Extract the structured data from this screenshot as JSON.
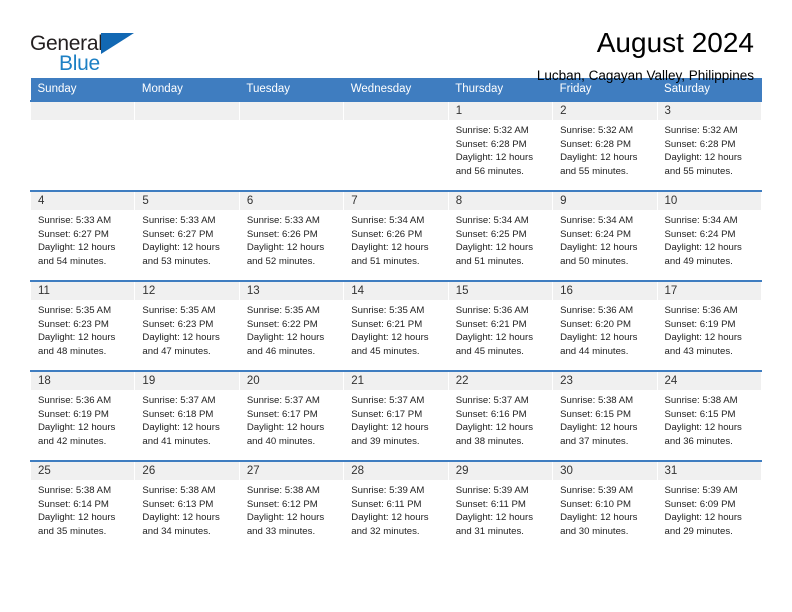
{
  "brand": {
    "name_part1": "General",
    "name_part2": "Blue",
    "logo_icon": "triangle-logo-icon"
  },
  "header": {
    "title": "August 2024",
    "subtitle": "Lucban, Cagayan Valley, Philippines"
  },
  "colors": {
    "header_blue": "#3f7dc0",
    "brand_blue": "#1d80c4",
    "logo_blue": "#1268b3",
    "daynum_bg": "#f0f0f0"
  },
  "calendar": {
    "weekday_headers": [
      "Sunday",
      "Monday",
      "Tuesday",
      "Wednesday",
      "Thursday",
      "Friday",
      "Saturday"
    ],
    "labels": {
      "sunrise": "Sunrise:",
      "sunset": "Sunset:",
      "daylight": "Daylight:"
    },
    "weeks": [
      [
        {
          "day": "",
          "empty": true
        },
        {
          "day": "",
          "empty": true
        },
        {
          "day": "",
          "empty": true
        },
        {
          "day": "",
          "empty": true
        },
        {
          "day": "1",
          "sunrise": "Sunrise: 5:32 AM",
          "sunset": "Sunset: 6:28 PM",
          "daylight_line1": "Daylight: 12 hours",
          "daylight_line2": "and 56 minutes."
        },
        {
          "day": "2",
          "sunrise": "Sunrise: 5:32 AM",
          "sunset": "Sunset: 6:28 PM",
          "daylight_line1": "Daylight: 12 hours",
          "daylight_line2": "and 55 minutes."
        },
        {
          "day": "3",
          "sunrise": "Sunrise: 5:32 AM",
          "sunset": "Sunset: 6:28 PM",
          "daylight_line1": "Daylight: 12 hours",
          "daylight_line2": "and 55 minutes."
        }
      ],
      [
        {
          "day": "4",
          "sunrise": "Sunrise: 5:33 AM",
          "sunset": "Sunset: 6:27 PM",
          "daylight_line1": "Daylight: 12 hours",
          "daylight_line2": "and 54 minutes."
        },
        {
          "day": "5",
          "sunrise": "Sunrise: 5:33 AM",
          "sunset": "Sunset: 6:27 PM",
          "daylight_line1": "Daylight: 12 hours",
          "daylight_line2": "and 53 minutes."
        },
        {
          "day": "6",
          "sunrise": "Sunrise: 5:33 AM",
          "sunset": "Sunset: 6:26 PM",
          "daylight_line1": "Daylight: 12 hours",
          "daylight_line2": "and 52 minutes."
        },
        {
          "day": "7",
          "sunrise": "Sunrise: 5:34 AM",
          "sunset": "Sunset: 6:26 PM",
          "daylight_line1": "Daylight: 12 hours",
          "daylight_line2": "and 51 minutes."
        },
        {
          "day": "8",
          "sunrise": "Sunrise: 5:34 AM",
          "sunset": "Sunset: 6:25 PM",
          "daylight_line1": "Daylight: 12 hours",
          "daylight_line2": "and 51 minutes."
        },
        {
          "day": "9",
          "sunrise": "Sunrise: 5:34 AM",
          "sunset": "Sunset: 6:24 PM",
          "daylight_line1": "Daylight: 12 hours",
          "daylight_line2": "and 50 minutes."
        },
        {
          "day": "10",
          "sunrise": "Sunrise: 5:34 AM",
          "sunset": "Sunset: 6:24 PM",
          "daylight_line1": "Daylight: 12 hours",
          "daylight_line2": "and 49 minutes."
        }
      ],
      [
        {
          "day": "11",
          "sunrise": "Sunrise: 5:35 AM",
          "sunset": "Sunset: 6:23 PM",
          "daylight_line1": "Daylight: 12 hours",
          "daylight_line2": "and 48 minutes."
        },
        {
          "day": "12",
          "sunrise": "Sunrise: 5:35 AM",
          "sunset": "Sunset: 6:23 PM",
          "daylight_line1": "Daylight: 12 hours",
          "daylight_line2": "and 47 minutes."
        },
        {
          "day": "13",
          "sunrise": "Sunrise: 5:35 AM",
          "sunset": "Sunset: 6:22 PM",
          "daylight_line1": "Daylight: 12 hours",
          "daylight_line2": "and 46 minutes."
        },
        {
          "day": "14",
          "sunrise": "Sunrise: 5:35 AM",
          "sunset": "Sunset: 6:21 PM",
          "daylight_line1": "Daylight: 12 hours",
          "daylight_line2": "and 45 minutes."
        },
        {
          "day": "15",
          "sunrise": "Sunrise: 5:36 AM",
          "sunset": "Sunset: 6:21 PM",
          "daylight_line1": "Daylight: 12 hours",
          "daylight_line2": "and 45 minutes."
        },
        {
          "day": "16",
          "sunrise": "Sunrise: 5:36 AM",
          "sunset": "Sunset: 6:20 PM",
          "daylight_line1": "Daylight: 12 hours",
          "daylight_line2": "and 44 minutes."
        },
        {
          "day": "17",
          "sunrise": "Sunrise: 5:36 AM",
          "sunset": "Sunset: 6:19 PM",
          "daylight_line1": "Daylight: 12 hours",
          "daylight_line2": "and 43 minutes."
        }
      ],
      [
        {
          "day": "18",
          "sunrise": "Sunrise: 5:36 AM",
          "sunset": "Sunset: 6:19 PM",
          "daylight_line1": "Daylight: 12 hours",
          "daylight_line2": "and 42 minutes."
        },
        {
          "day": "19",
          "sunrise": "Sunrise: 5:37 AM",
          "sunset": "Sunset: 6:18 PM",
          "daylight_line1": "Daylight: 12 hours",
          "daylight_line2": "and 41 minutes."
        },
        {
          "day": "20",
          "sunrise": "Sunrise: 5:37 AM",
          "sunset": "Sunset: 6:17 PM",
          "daylight_line1": "Daylight: 12 hours",
          "daylight_line2": "and 40 minutes."
        },
        {
          "day": "21",
          "sunrise": "Sunrise: 5:37 AM",
          "sunset": "Sunset: 6:17 PM",
          "daylight_line1": "Daylight: 12 hours",
          "daylight_line2": "and 39 minutes."
        },
        {
          "day": "22",
          "sunrise": "Sunrise: 5:37 AM",
          "sunset": "Sunset: 6:16 PM",
          "daylight_line1": "Daylight: 12 hours",
          "daylight_line2": "and 38 minutes."
        },
        {
          "day": "23",
          "sunrise": "Sunrise: 5:38 AM",
          "sunset": "Sunset: 6:15 PM",
          "daylight_line1": "Daylight: 12 hours",
          "daylight_line2": "and 37 minutes."
        },
        {
          "day": "24",
          "sunrise": "Sunrise: 5:38 AM",
          "sunset": "Sunset: 6:15 PM",
          "daylight_line1": "Daylight: 12 hours",
          "daylight_line2": "and 36 minutes."
        }
      ],
      [
        {
          "day": "25",
          "sunrise": "Sunrise: 5:38 AM",
          "sunset": "Sunset: 6:14 PM",
          "daylight_line1": "Daylight: 12 hours",
          "daylight_line2": "and 35 minutes."
        },
        {
          "day": "26",
          "sunrise": "Sunrise: 5:38 AM",
          "sunset": "Sunset: 6:13 PM",
          "daylight_line1": "Daylight: 12 hours",
          "daylight_line2": "and 34 minutes."
        },
        {
          "day": "27",
          "sunrise": "Sunrise: 5:38 AM",
          "sunset": "Sunset: 6:12 PM",
          "daylight_line1": "Daylight: 12 hours",
          "daylight_line2": "and 33 minutes."
        },
        {
          "day": "28",
          "sunrise": "Sunrise: 5:39 AM",
          "sunset": "Sunset: 6:11 PM",
          "daylight_line1": "Daylight: 12 hours",
          "daylight_line2": "and 32 minutes."
        },
        {
          "day": "29",
          "sunrise": "Sunrise: 5:39 AM",
          "sunset": "Sunset: 6:11 PM",
          "daylight_line1": "Daylight: 12 hours",
          "daylight_line2": "and 31 minutes."
        },
        {
          "day": "30",
          "sunrise": "Sunrise: 5:39 AM",
          "sunset": "Sunset: 6:10 PM",
          "daylight_line1": "Daylight: 12 hours",
          "daylight_line2": "and 30 minutes."
        },
        {
          "day": "31",
          "sunrise": "Sunrise: 5:39 AM",
          "sunset": "Sunset: 6:09 PM",
          "daylight_line1": "Daylight: 12 hours",
          "daylight_line2": "and 29 minutes."
        }
      ]
    ]
  }
}
